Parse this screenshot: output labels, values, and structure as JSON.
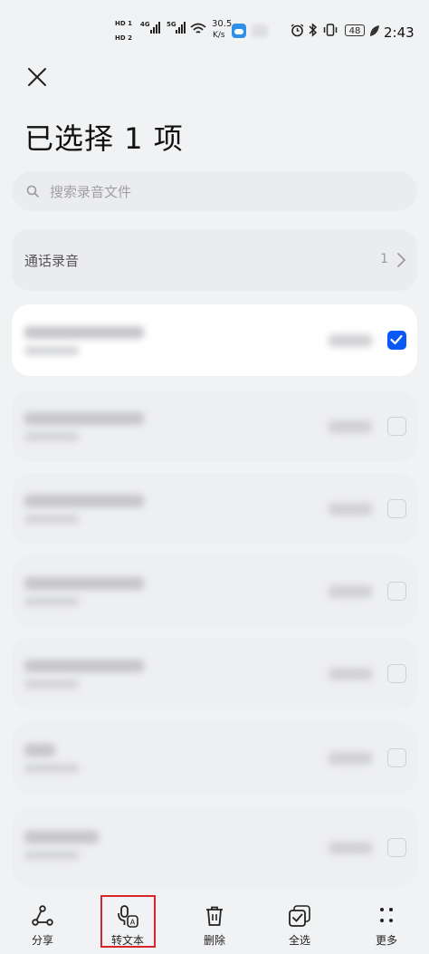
{
  "status_bar": {
    "sim1": "HD 1",
    "sim2": "HD 2",
    "network1": "4G",
    "network2": "5G",
    "net_speed_value": "30.5",
    "net_speed_unit": "K/s",
    "battery": "48",
    "time": "2:43"
  },
  "header": {
    "title": "已选择 1 项"
  },
  "search": {
    "placeholder": "搜索录音文件"
  },
  "folder": {
    "label": "通话录音",
    "count": "1"
  },
  "recordings": [
    {
      "selected": true
    },
    {
      "selected": false
    },
    {
      "selected": false
    },
    {
      "selected": false
    },
    {
      "selected": false
    },
    {
      "selected": false
    },
    {
      "selected": false
    }
  ],
  "bottom_bar": {
    "share": "分享",
    "transcribe": "转文本",
    "delete": "删除",
    "select_all": "全选",
    "more": "更多"
  },
  "colors": {
    "accent": "#0a59f7",
    "highlight": "#d7262b"
  }
}
